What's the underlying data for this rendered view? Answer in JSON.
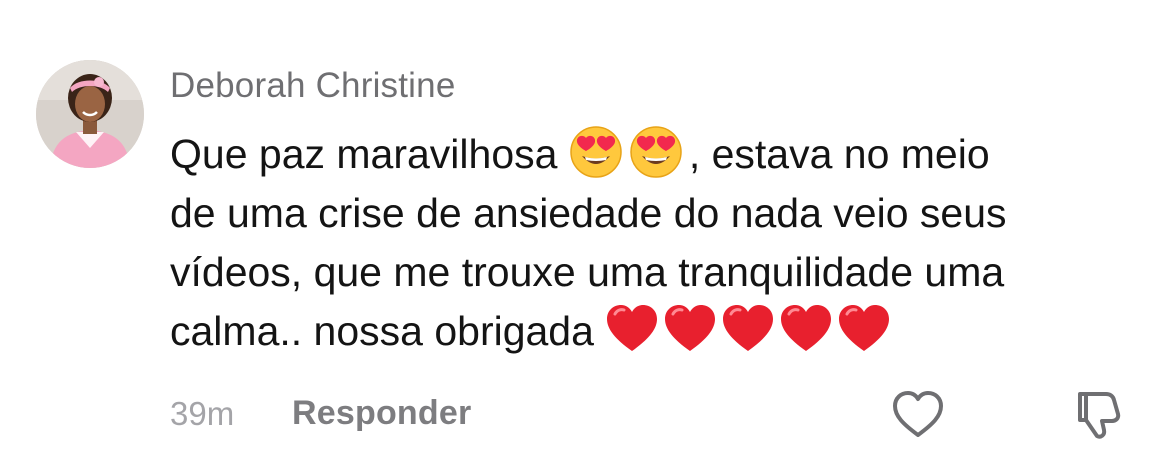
{
  "comment": {
    "author": "Deborah Christine",
    "lines": [
      [
        "Que paz maravilhosa ",
        "",
        ", estava no meio"
      ],
      [
        "de uma crise de ansiedade do nada veio seus"
      ],
      [
        "vídeos, que me trouxe uma tranquilidade uma"
      ],
      [
        "calma.. nossa obrigada "
      ]
    ],
    "line1_part1": "Que paz maravilhosa ",
    "line1_part2": ", estava no meio",
    "line2": "de uma crise de ansiedade do nada veio seus",
    "line3": "vídeos, que me trouxe uma tranquilidade uma",
    "line4": "calma.. nossa obrigada ",
    "emojis_line1": [
      "heart-eyes-emoji",
      "heart-eyes-emoji"
    ],
    "emojis_line4": [
      "red-heart-emoji",
      "red-heart-emoji",
      "red-heart-emoji",
      "red-heart-emoji",
      "red-heart-emoji"
    ],
    "timestamp": "39m",
    "reply_label": "Responder"
  },
  "actions": {
    "like_icon": "heart-outline-icon",
    "dislike_icon": "thumbs-down-icon"
  },
  "colors": {
    "author": "#6f6f72",
    "text": "#141414",
    "timestamp": "#a4a4a8",
    "reply": "#7d7d80",
    "icon": "#6f6f72",
    "avatar_outfit": "#f4a6c2"
  }
}
